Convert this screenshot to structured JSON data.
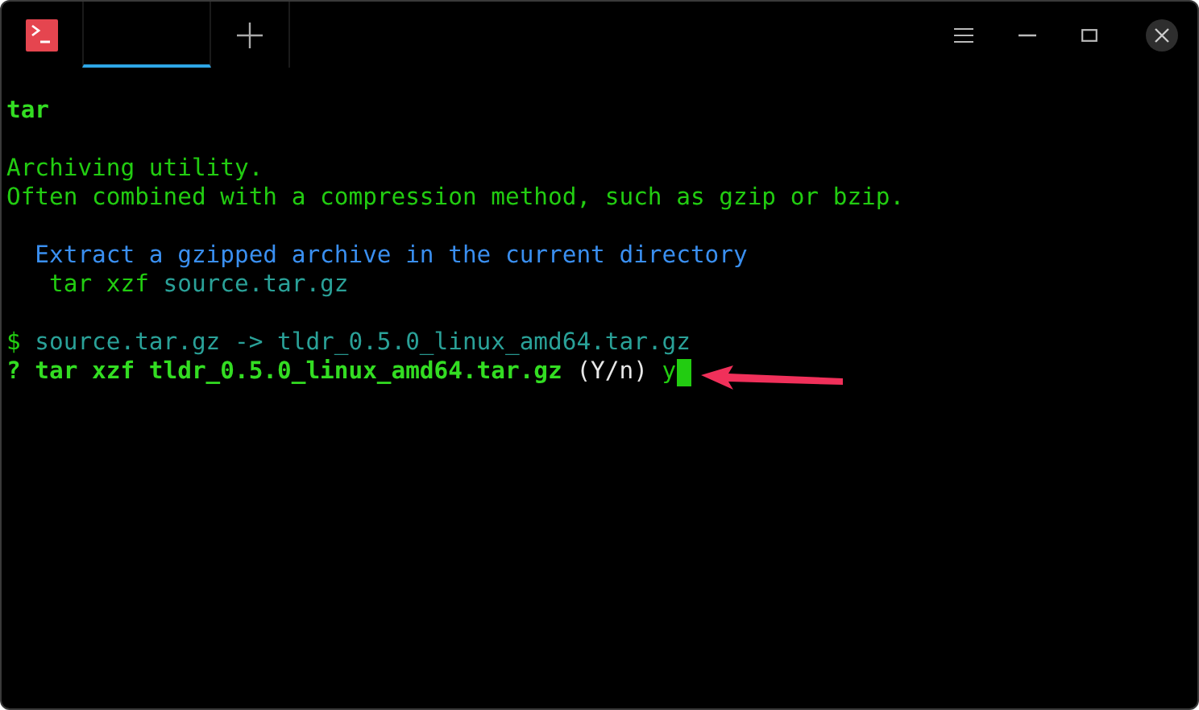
{
  "tabs": [
    {
      "selected": true
    }
  ],
  "terminal": {
    "blocks": [
      {
        "lines": [
          {
            "segments": [
              {
                "kind": "strong",
                "text": "tar"
              }
            ]
          }
        ]
      },
      {
        "lines": [
          {
            "segments": [
              {
                "kind": "green",
                "text": "Archiving utility."
              }
            ]
          },
          {
            "segments": [
              {
                "kind": "green",
                "text": "Often combined with a compression method, such as gzip or bzip."
              }
            ]
          }
        ]
      },
      {
        "lines": [
          {
            "segments": [
              {
                "kind": "blue",
                "text": "  Extract a gzipped archive in the current directory"
              }
            ]
          },
          {
            "segments": [
              {
                "kind": "green",
                "text": "   tar xzf"
              },
              {
                "kind": "teal",
                "text": " source.tar.gz"
              }
            ]
          }
        ]
      },
      {
        "lines": [
          {
            "segments": [
              {
                "kind": "green",
                "text": "$"
              },
              {
                "kind": "teal",
                "text": " source.tar.gz -> tldr_0.5.0_linux_amd64.tar.gz"
              }
            ]
          },
          {
            "cursor": true,
            "segments": [
              {
                "kind": "strong",
                "text": "? tar xzf tldr_0.5.0_linux_amd64.tar.gz"
              },
              {
                "kind": "plain",
                "text": " (Y/n)"
              },
              {
                "kind": "green",
                "text": " y"
              }
            ]
          }
        ]
      }
    ]
  }
}
